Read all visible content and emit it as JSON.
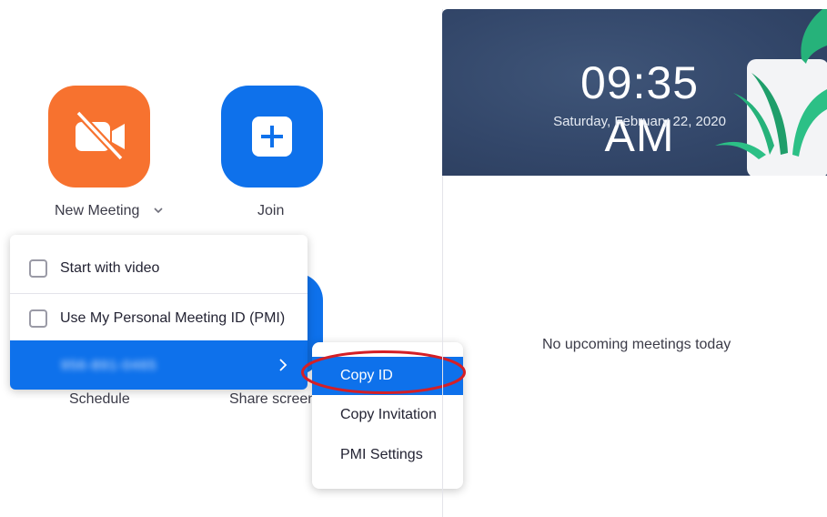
{
  "home": {
    "new_meeting_label": "New Meeting",
    "join_label": "Join",
    "schedule_label": "Schedule",
    "share_screen_label": "Share screen"
  },
  "icons": {
    "new_meeting": "video-off-icon",
    "join": "plus-icon",
    "dropdown": "chevron-down-icon",
    "submenu_arrow": "chevron-right-icon"
  },
  "dropdown": {
    "items": [
      {
        "label": "Start with video",
        "checked": false
      },
      {
        "label": "Use My Personal Meeting ID (PMI)",
        "checked": false
      },
      {
        "label": "956-891-0465",
        "blurred": true
      }
    ]
  },
  "submenu": {
    "items": [
      {
        "label": "Copy ID",
        "selected": true
      },
      {
        "label": "Copy Invitation"
      },
      {
        "label": "PMI Settings"
      }
    ]
  },
  "banner": {
    "time": "09:35 AM",
    "date": "Saturday, February 22, 2020"
  },
  "meetings": {
    "empty_text": "No upcoming meetings today"
  },
  "colors": {
    "accent_blue": "#0e71eb",
    "new_meeting_orange": "#f7722f",
    "banner_navy": "#33476a",
    "highlight_red": "#d41f26"
  }
}
